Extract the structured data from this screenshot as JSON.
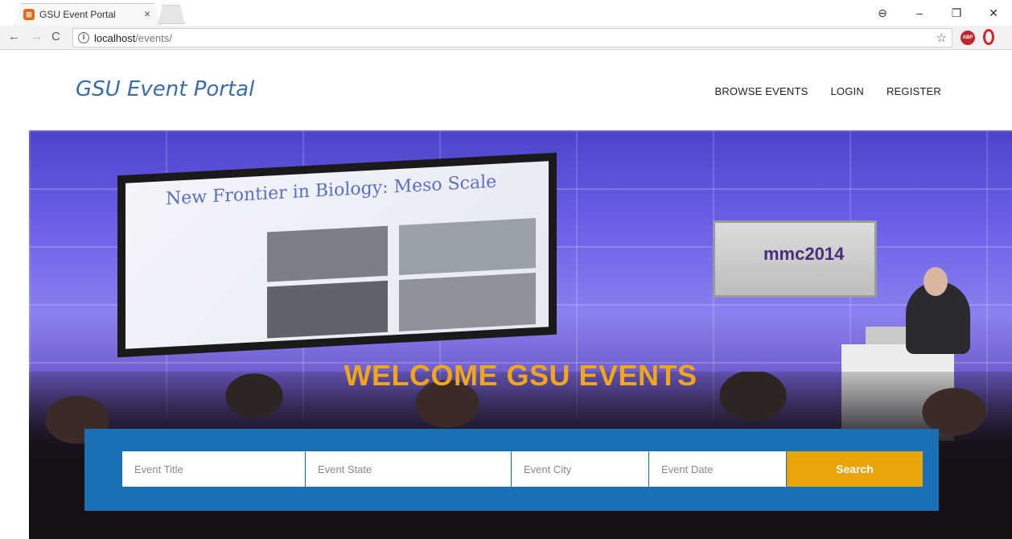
{
  "browser": {
    "tab_title": "GSU Event Portal",
    "tab_favicon": "⊠",
    "tab_close": "×",
    "url_host": "localhost",
    "url_path": "/events/",
    "win_profile": "⊖",
    "win_minimize": "–",
    "win_restore": "❐",
    "win_close": "✕",
    "ext_abp_label": "ABP"
  },
  "header": {
    "brand": "GSU Event Portal",
    "nav": [
      {
        "label": "BROWSE EVENTS"
      },
      {
        "label": "LOGIN"
      },
      {
        "label": "REGISTER"
      }
    ]
  },
  "hero": {
    "screen_title": "New Frontier in Biology: Meso Scale",
    "poster_text": "mmc2014",
    "title": "WELCOME GSU EVENTS"
  },
  "search": {
    "title_placeholder": "Event Title",
    "state_placeholder": "Event State",
    "city_placeholder": "Event City",
    "date_placeholder": "Event Date",
    "button_label": "Search"
  },
  "colors": {
    "brand": "#3a6ea5",
    "hero_title": "#f0a51a",
    "search_panel": "#1b6fb5",
    "search_button": "#e8a50a"
  }
}
